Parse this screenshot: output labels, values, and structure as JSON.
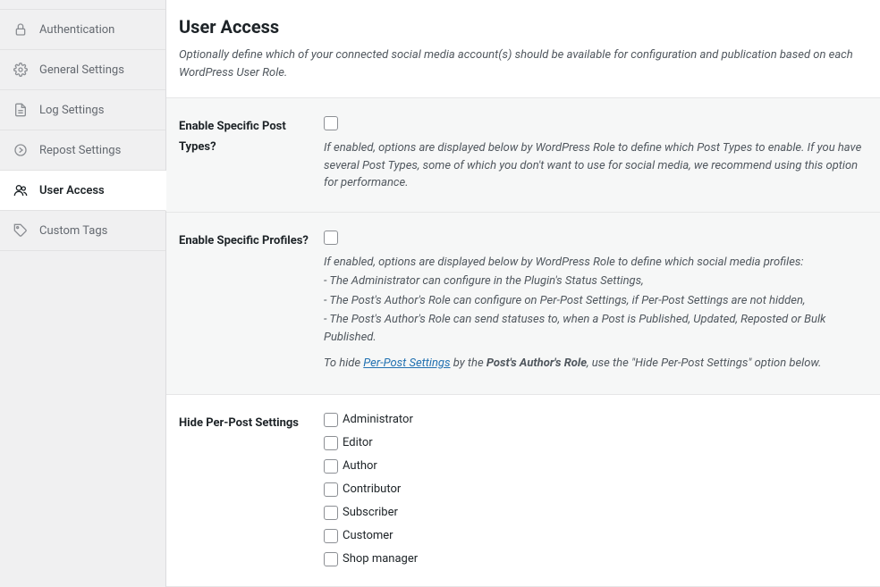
{
  "sidebar": {
    "items": [
      {
        "label": "Authentication"
      },
      {
        "label": "General Settings"
      },
      {
        "label": "Log Settings"
      },
      {
        "label": "Repost Settings"
      },
      {
        "label": "User Access"
      },
      {
        "label": "Custom Tags"
      }
    ]
  },
  "header": {
    "title": "User Access",
    "description": "Optionally define which of your connected social media account(s) should be available for configuration and publication based on each WordPress User Role."
  },
  "section_post_types": {
    "label": "Enable Specific Post Types?",
    "help": "If enabled, options are displayed below by WordPress Role to define which Post Types to enable. If you have several Post Types, some of which you don't want to use for social media, we recommend using this option for performance."
  },
  "section_profiles": {
    "label": "Enable Specific Profiles?",
    "help_intro": "If enabled, options are displayed below by WordPress Role to define which social media profiles:",
    "bullet1": "- The Administrator can configure in the Plugin's Status Settings,",
    "bullet2": "- The Post's Author's Role can configure on Per-Post Settings, if Per-Post Settings are not hidden,",
    "bullet3": "- The Post's Author's Role can send statuses to, when a Post is Published, Updated, Reposted or Bulk Published.",
    "hide_pre": "To hide ",
    "link_text": "Per-Post Settings",
    "hide_mid": " by the ",
    "hide_bold": "Post's Author's Role",
    "hide_post": ", use the \"Hide Per-Post Settings\" option below."
  },
  "section_hide": {
    "label": "Hide Per-Post Settings",
    "roles": [
      {
        "label": "Administrator"
      },
      {
        "label": "Editor"
      },
      {
        "label": "Author"
      },
      {
        "label": "Contributor"
      },
      {
        "label": "Subscriber"
      },
      {
        "label": "Customer"
      },
      {
        "label": "Shop manager"
      }
    ]
  }
}
